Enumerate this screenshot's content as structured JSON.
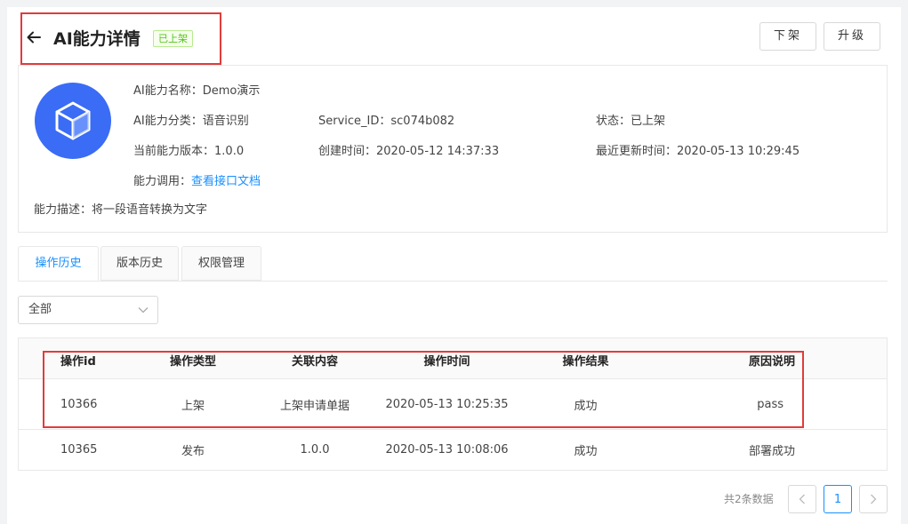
{
  "header": {
    "title": "AI能力详情",
    "status_tag": "已上架",
    "unshelve_label": "下架",
    "upgrade_label": "升级"
  },
  "info": {
    "name_label": "AI能力名称：",
    "name_value": "Demo演示",
    "category_label": "AI能力分类：",
    "category_value": "语音识别",
    "service_id_label": "Service_ID：",
    "service_id_value": "sc074b082",
    "status_label": "状态：",
    "status_value": "已上架",
    "version_label": "当前能力版本：",
    "version_value": "1.0.0",
    "created_label": "创建时间：",
    "created_value": "2020-05-12 14:37:33",
    "updated_label": "最近更新时间：",
    "updated_value": "2020-05-13 10:29:45",
    "invoke_label": "能力调用：",
    "invoke_link": "查看接口文档",
    "desc_label": "能力描述：",
    "desc_value": "将一段语音转换为文字"
  },
  "tabs": [
    {
      "label": "操作历史"
    },
    {
      "label": "版本历史"
    },
    {
      "label": "权限管理"
    }
  ],
  "filter": {
    "selected": "全部"
  },
  "table": {
    "columns": [
      "操作id",
      "操作类型",
      "关联内容",
      "操作时间",
      "操作结果",
      "原因说明"
    ],
    "rows": [
      {
        "id": "10366",
        "type": "上架",
        "related": "上架申请单据",
        "time": "2020-05-13 10:25:35",
        "result": "成功",
        "reason": "pass"
      },
      {
        "id": "10365",
        "type": "发布",
        "related": "1.0.0",
        "time": "2020-05-13 10:08:06",
        "result": "成功",
        "reason": "部署成功"
      }
    ]
  },
  "pagination": {
    "total_text": "共2条数据",
    "current_page": "1"
  },
  "colors": {
    "accent": "#1890ff",
    "success": "#52c41a",
    "logo": "#3a6cf6",
    "highlight": "#e03c3c"
  },
  "icons": {
    "back": "arrow-left-icon",
    "logo": "cube-icon",
    "dropdown": "chevron-down-icon",
    "prev": "chevron-left-icon",
    "next": "chevron-right-icon"
  }
}
